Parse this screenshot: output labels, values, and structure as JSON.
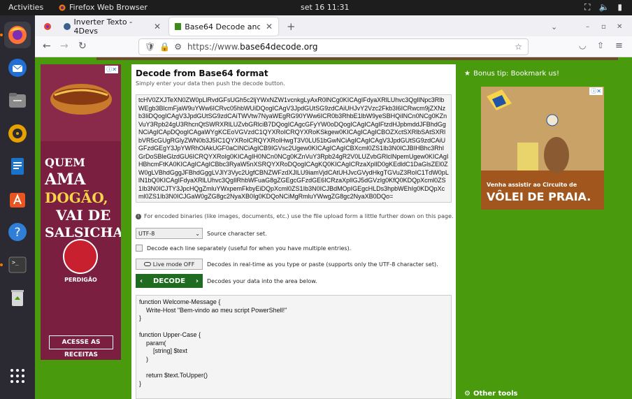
{
  "topbar": {
    "activities": "Activities",
    "app_name": "Firefox Web Browser",
    "clock": "set 16  11:31"
  },
  "tabs": [
    {
      "label": "Inverter Texto - 4Devs"
    },
    {
      "label": "Base64 Decode and Enco"
    }
  ],
  "url": {
    "prefix": "https://www.",
    "domain": "base64decode.org"
  },
  "page": {
    "title": "Decode from Base64 format",
    "subtitle": "Simply enter your data then push the decode button.",
    "input_text": "tcHV0ZXJTeXN0ZW0pLlRvdGFsUGh5c2ljYWxNZW1vcnkgLyAxR0lNCg0KICAgIFdyaXRlLUhvc3QgIlNpc3RlbWEgb3BlcmFjaW9uYWw6ICRvc05hbWUiDQogICAgV3JpdGUtSG9zdCAiUHJvY2Vzc2Fkb3I6ICRwcm9jZXNzb3IiDQogICAgV3JpdGUtSG9zdCAiTWVtw7NyaWEgRG90YWw6ICR0b3RhbE1lbW9yeSBHQiINCn0NCg0KZnVuY3Rpb24gU3RhcnQtSWRXRlLUZvbGRlciB7DQogICAgcGFyYW0oDQogICAgICAgIFtzdHJpbmddJFBhdGgNCiAgICApDQogICAgaWYgKCEoVGVzdC1QYXRoICRQYXRoKSkgew0KICAgICAgICBOZXctSXRlbSAtSXRlbVR5cGUgRGlyZWN0b3J5IC1QYXRoICRQYXRoIHwgT3V0LU51bGwNCiAgICAgICAgV3JpdGUtSG9zdCAiUGFzdGEgY3JpYWRhOiAkUGF0aCINCiAgICB9IGVsc2Ugew0KICAgICAgICBXcml0ZS1Ib3N0ICJBIHBhc3RhIGrDoSBleGlzdGU6ICRQYXRoIg0KICAgIH0NCn0NCg0KZnVuY3Rpb24gR2V0LUZvbGRlclNpemUgew0KICAgIHBhcmFtKA0KICAgICAgICBbc3RyaW5nXSRQYXRoDQogICAgKQ0KICAgICRzaXplID0gKEdldC1DaGlsZEl0ZW0gLVBhdGggJFBhdGggLVJlY3Vyc2UgfCBNZWFzdXJlLU9iamVjdCAtUHJvcGVydHkgTGVuZ3RoIC1TdW0pLlN1bQ0KICAgIFdyaXRlLUhvc3QgIlRhbWFuaG8gZGEgcGFzdGE6ICRzaXplIGJ5dGVzIg0KfQ0KDQpXcml0ZS1Ib3N0ICJTY3JpcHQgZmluYWxpemFkbyEiDQpXcml0ZS1Ib3N0ICJBdMOpIGEgcHLDs3hpbWEhIg0KDQpXcml0ZS1Ib3N0ICJGaW0gZG8gc2NyaXB0Ig0KDQoNCiMgRmluYWwgZG8gc2NyaXB0DQo=",
    "binary_note": "For encoded binaries (like images, documents, etc.) use the file upload form a little further down on this page.",
    "charset_value": "UTF-8",
    "charset_label": "Source character set.",
    "each_line_label": "Decode each line separately (useful for when you have multiple entries).",
    "live_mode_label": "Live mode OFF",
    "live_mode_desc": "Decodes in real-time as you type or paste (supports only the UTF-8 character set).",
    "decode_label": "DECODE",
    "decode_desc": "Decodes your data into the area below.",
    "output_text": "function Welcome-Message {\n    Write-Host \"Bem-vindo ao meu script PowerShell!\"\n}\n\nfunction Upper-Case {\n    param(\n        [string] $text\n    )\n\n    return $text.ToUpper()\n}"
  },
  "sidebar": {
    "bonus_tip": "Bonus tip: Bookmark us!",
    "other_tools": "Other tools"
  },
  "ads": {
    "left_lines": [
      "QUEM",
      "AMA",
      "DOGÃO,",
      "VAI DE",
      "SALSICHA"
    ],
    "left_brand": "PERDIGÃO",
    "left_cta": "ACESSE AS RECEITAS",
    "right_line1": "Venha assistir ao Circuito de",
    "right_line2": "VÔLEI DE PRAIA."
  },
  "colors": {
    "page_bg": "#4a9a0e",
    "decode_btn": "#1f6b1f",
    "ad_left_bg": "#7a1f3f",
    "ad_right_bg": "#c9a268"
  }
}
